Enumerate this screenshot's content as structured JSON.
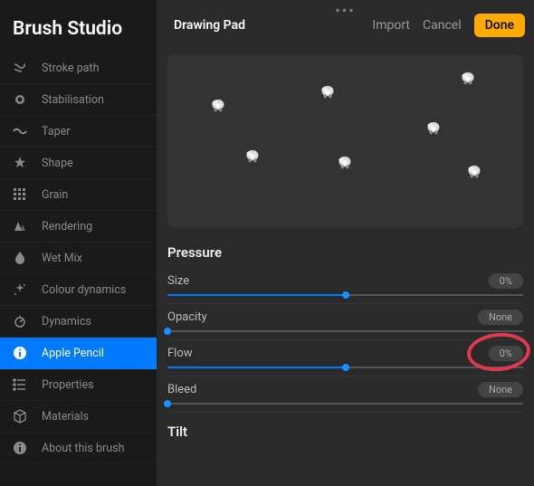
{
  "title": "Brush Studio",
  "sidebar": {
    "items": [
      {
        "label": "Stroke path",
        "icon": "path-icon"
      },
      {
        "label": "Stabilisation",
        "icon": "circle-icon"
      },
      {
        "label": "Taper",
        "icon": "wave-icon"
      },
      {
        "label": "Shape",
        "icon": "star-icon"
      },
      {
        "label": "Grain",
        "icon": "grid-icon"
      },
      {
        "label": "Rendering",
        "icon": "triangle-icon"
      },
      {
        "label": "Wet Mix",
        "icon": "drop-icon"
      },
      {
        "label": "Colour dynamics",
        "icon": "sparkle-icon"
      },
      {
        "label": "Dynamics",
        "icon": "speed-icon"
      },
      {
        "label": "Apple Pencil",
        "icon": "info-icon",
        "selected": true
      },
      {
        "label": "Properties",
        "icon": "list-icon"
      },
      {
        "label": "Materials",
        "icon": "cube-icon"
      },
      {
        "label": "About this brush",
        "icon": "about-icon"
      }
    ]
  },
  "header": {
    "pad_label": "Drawing Pad",
    "import": "Import",
    "cancel": "Cancel",
    "done": "Done"
  },
  "pressure": {
    "title": "Pressure",
    "controls": [
      {
        "label": "Size",
        "value": "0%",
        "pos": 50
      },
      {
        "label": "Opacity",
        "value": "None",
        "pos": 0
      },
      {
        "label": "Flow",
        "value": "0%",
        "pos": 50,
        "annotated": true
      },
      {
        "label": "Bleed",
        "value": "None",
        "pos": 0
      }
    ]
  },
  "tilt": {
    "title": "Tilt"
  }
}
